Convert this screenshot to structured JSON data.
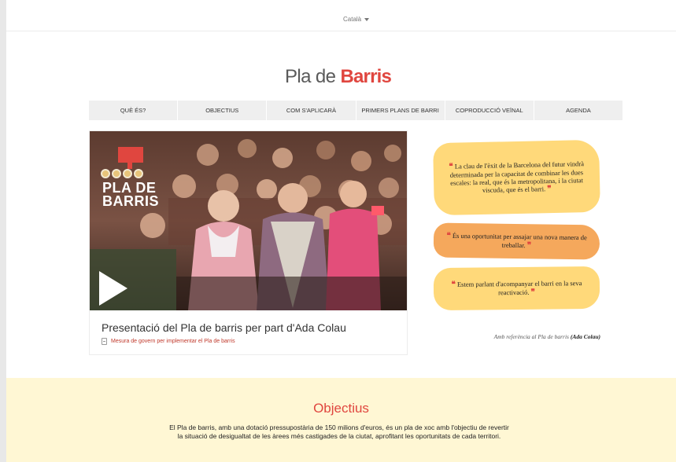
{
  "topbar": {
    "language": "Català"
  },
  "logo": {
    "part1": "Pla de ",
    "part2": "Barris"
  },
  "nav": {
    "items": [
      {
        "label": "QUÈ ÉS?"
      },
      {
        "label": "OBJECTIUS"
      },
      {
        "label": "COM S'APLICARÀ"
      },
      {
        "label": "PRIMERS PLANS DE BARRI"
      },
      {
        "label": "COPRODUCCIÓ VEÏNAL"
      },
      {
        "label": "AGENDA"
      }
    ]
  },
  "video": {
    "badge_line1": "PLA DE",
    "badge_line2": "BARRIS",
    "title": "Presentació del Pla de barris per part d'Ada Colau",
    "doc_link": "Mesura de govern per implementar el Pla de barris"
  },
  "quotes": [
    {
      "text": "La clau de l'èxit de la Barcelona del futur vindrà determinada per la capacitat de combinar les dues escales: la real, que és la metropolitana, i la ciutat viscuda, que és el barri."
    },
    {
      "text": "És una oportunitat per assajar una nova manera de treballar."
    },
    {
      "text": "Estem parlant d'acompanyar el barri en la seva reactivació."
    }
  ],
  "quote_open": "❝",
  "quote_close": "❞",
  "attribution": {
    "prefix": "Amb referència al Pla de barris ",
    "author": "(Ada Colau)"
  },
  "objectius": {
    "title": "Objectius",
    "text": "El Pla de barris, amb una dotació pressupostària de 150 milions d'euros, és un pla de xoc amb l'objectiu de revertir la situació de desigualtat de les àrees més castigades de la ciutat, aprofitant les oportunitats de cada territori."
  },
  "colors": {
    "accent": "#e0463f",
    "quote_yellow": "#ffd97a",
    "quote_orange": "#f5a85c",
    "section_bg": "#fff7d4"
  }
}
